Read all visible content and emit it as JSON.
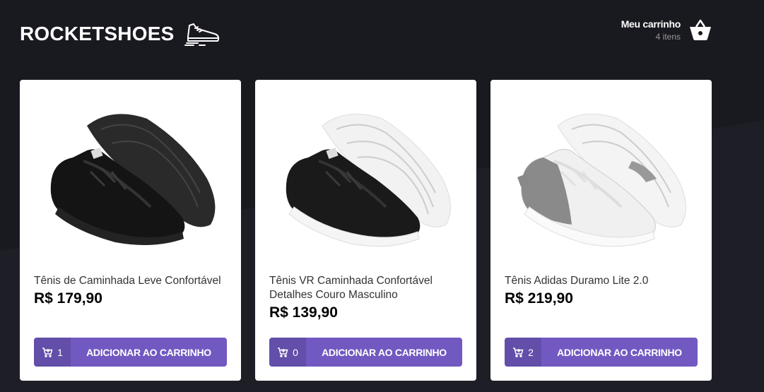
{
  "header": {
    "logo_text": "ROCKETSHOES",
    "logo_icon": "sneaker-icon",
    "cart_title": "Meu carrinho",
    "cart_count": "4 itens",
    "cart_icon": "basket-icon"
  },
  "colors": {
    "background": "#191920",
    "accent": "#7159c1",
    "card": "#ffffff"
  },
  "products": [
    {
      "title": "Tênis de Caminhada Leve Confortável",
      "price": "R$ 179,90",
      "amount": "1",
      "button_label": "ADICIONAR AO CARRINHO",
      "image": "black-sneaker"
    },
    {
      "title": "Tênis VR Caminhada Confortável Detalhes Couro Masculino",
      "price": "R$ 139,90",
      "amount": "0",
      "button_label": "ADICIONAR AO CARRINHO",
      "image": "black-white-sneaker"
    },
    {
      "title": "Tênis Adidas Duramo Lite 2.0",
      "price": "R$ 219,90",
      "amount": "2",
      "button_label": "ADICIONAR AO CARRINHO",
      "image": "white-grey-sneaker"
    }
  ]
}
